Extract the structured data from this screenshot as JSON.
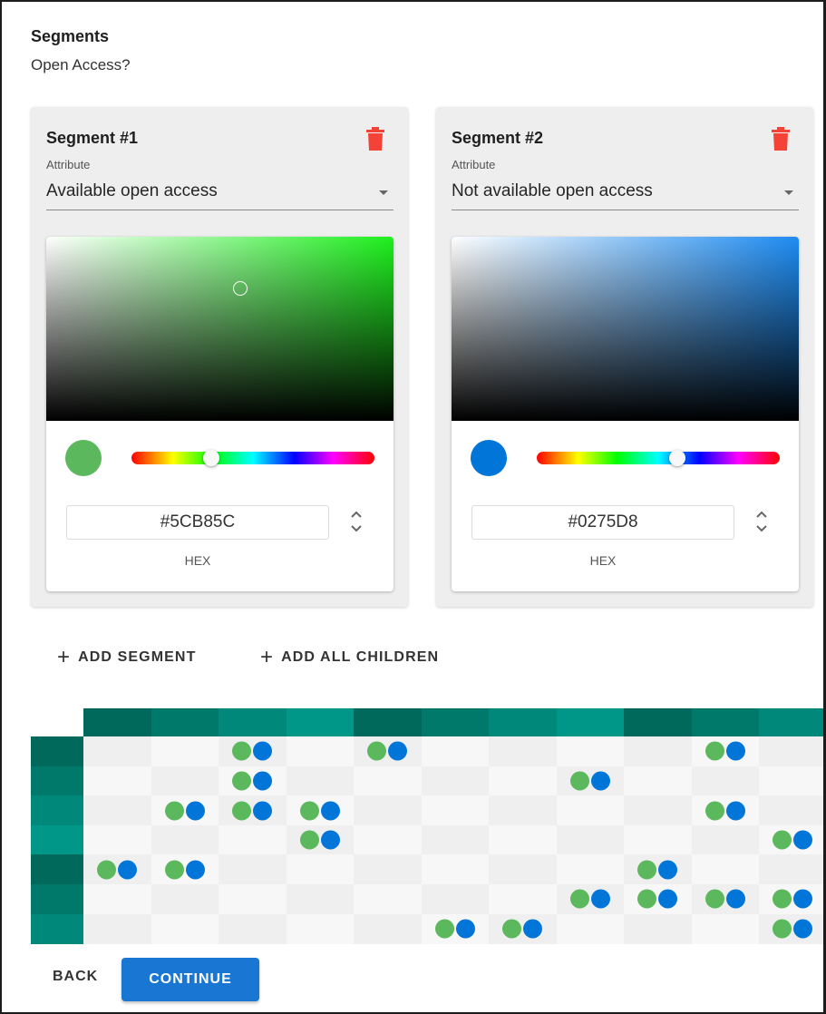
{
  "header": {
    "title": "Segments",
    "subtitle": "Open Access?"
  },
  "segments": [
    {
      "title": "Segment #1",
      "attribute_label": "Attribute",
      "attribute_value": "Available open access",
      "hex_value": "#5CB85C",
      "hex_label": "HEX",
      "color": "#5CB85C",
      "hue_color": "#1ef01e",
      "hue_position": 0.33,
      "saturation": 0.56,
      "brightness": 0.72
    },
    {
      "title": "Segment #2",
      "attribute_label": "Attribute",
      "attribute_value": "Not available open access",
      "hex_value": "#0275D8",
      "hex_label": "HEX",
      "color": "#0275D8",
      "hue_color": "#1e8cf2",
      "hue_position": 0.58,
      "saturation": 0.99,
      "brightness": 0.85
    }
  ],
  "actions": {
    "add_segment": "ADD SEGMENT",
    "add_all_children": "ADD ALL CHILDREN",
    "back": "BACK",
    "continue": "CONTINUE"
  },
  "colors": {
    "delete_icon": "#f44336",
    "primary": "#1976d2",
    "dot_a": "#5CB85C",
    "dot_b": "#0275D8"
  },
  "grid": {
    "column_header_colors": [
      "#00695c",
      "#00796b",
      "#00897b",
      "#009688",
      "#00695c",
      "#00796b",
      "#00897b",
      "#009688",
      "#00695c",
      "#00796b",
      "#00897b"
    ],
    "row_header_colors": [
      "#00695c",
      "#00796b",
      "#00897b",
      "#009688",
      "#00695c",
      "#00796b",
      "#00897b"
    ],
    "occupied": [
      [
        0,
        2
      ],
      [
        0,
        4
      ],
      [
        0,
        9
      ],
      [
        1,
        2
      ],
      [
        1,
        7
      ],
      [
        2,
        1
      ],
      [
        2,
        2
      ],
      [
        2,
        3
      ],
      [
        2,
        9
      ],
      [
        3,
        3
      ],
      [
        3,
        10
      ],
      [
        4,
        0
      ],
      [
        4,
        1
      ],
      [
        4,
        8
      ],
      [
        5,
        7
      ],
      [
        5,
        8
      ],
      [
        5,
        9
      ],
      [
        5,
        10
      ],
      [
        6,
        5
      ],
      [
        6,
        6
      ],
      [
        6,
        10
      ]
    ]
  }
}
